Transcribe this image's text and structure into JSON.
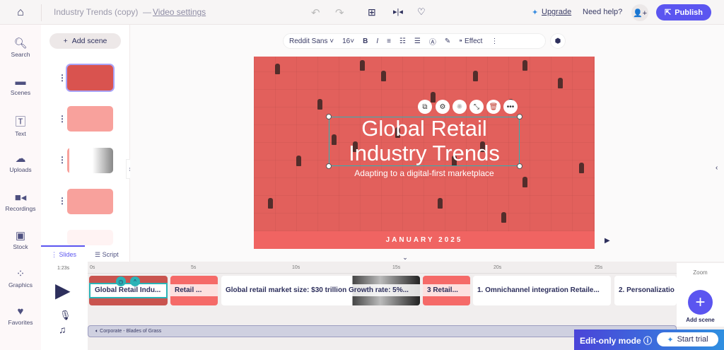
{
  "header": {
    "project_title": "Industry Trends (copy)",
    "separator": "—",
    "video_settings": "Video settings",
    "upgrade": "Upgrade",
    "need_help": "Need help?",
    "publish": "Publish"
  },
  "rail": [
    {
      "label": "Search",
      "icon": "search-icon"
    },
    {
      "label": "Scenes",
      "icon": "clapper-icon"
    },
    {
      "label": "Text",
      "icon": "text-icon"
    },
    {
      "label": "Uploads",
      "icon": "upload-icon"
    },
    {
      "label": "Recordings",
      "icon": "camera-icon"
    },
    {
      "label": "Stock",
      "icon": "image-icon"
    },
    {
      "label": "Graphics",
      "icon": "shapes-icon"
    },
    {
      "label": "Favorites",
      "icon": "heart-icon"
    }
  ],
  "scenes_panel": {
    "add_scene": "Add scene",
    "tabs": {
      "slides": "Slides",
      "script": "Script"
    }
  },
  "toolbar": {
    "font": "Reddit Sans",
    "size": "16",
    "effect": "Effect"
  },
  "slide": {
    "title_line1": "Global Retail",
    "title_line2": "Industry Trends",
    "subtitle": "Adapting to a digital-first marketplace",
    "footer": "JANUARY 2025",
    "accent": "#f06462"
  },
  "timeline": {
    "duration": "1:23s",
    "ticks": [
      "0s",
      "5s",
      "10s",
      "15s",
      "20s",
      "25s"
    ],
    "clips": [
      {
        "label": "Global Retail Indu..."
      },
      {
        "label": "Retail ..."
      },
      {
        "label": "Global retail market size: $30 trillion Growth rate: 5%..."
      },
      {
        "label": "3 Retail..."
      },
      {
        "label": "1. Omnichannel integration Retaile..."
      },
      {
        "label": "2. Personalizatio"
      }
    ],
    "audio": "Corporate - Blades of Grass",
    "zoom": "Zoom",
    "add_scene": "Add scene"
  },
  "banner": {
    "mode": "Edit-only mode",
    "start_trial": "Start trial"
  },
  "colors": {
    "brand": "#5b55f0",
    "teal": "#2bb3b6",
    "coral": "#f06462"
  }
}
